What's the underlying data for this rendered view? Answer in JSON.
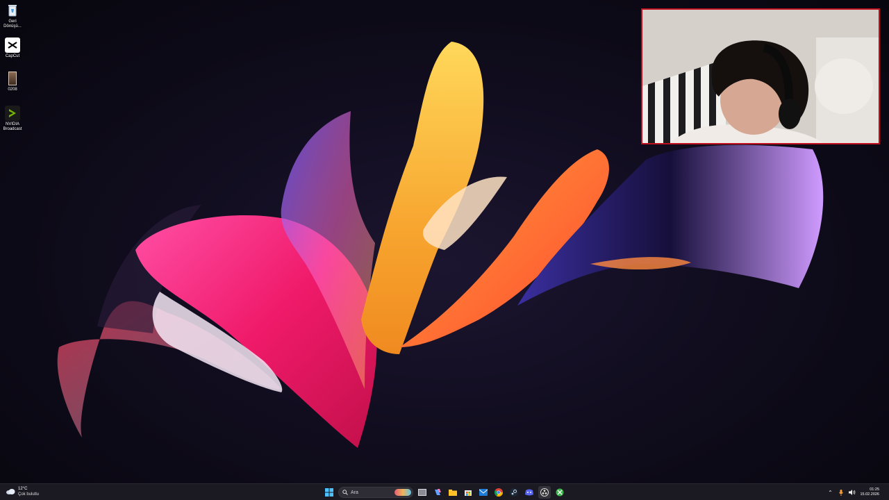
{
  "desktop": {
    "icons": [
      {
        "label": "Geri Dönüşü...",
        "icon": "recycle-bin-icon"
      },
      {
        "label": "CapCut",
        "icon": "capcut-icon"
      },
      {
        "label": "0208",
        "icon": "image-file-icon"
      },
      {
        "label": "NVIDIA Broadcast",
        "icon": "nvidia-broadcast-icon"
      }
    ]
  },
  "taskbar": {
    "weather": {
      "temp": "12°C",
      "condition": "Çok bulutlu",
      "icon": "cloud-icon"
    },
    "search": {
      "placeholder": "Ara"
    },
    "apps": [
      "start-icon",
      "task-view-icon",
      "copilot-icon",
      "file-explorer-icon",
      "store-icon",
      "mail-icon",
      "chrome-icon",
      "steam-icon",
      "discord-icon",
      "obs-icon",
      "xbox-icon"
    ],
    "tray": {
      "time": "01:25",
      "date": "15.02.2026"
    }
  },
  "colors": {
    "taskbar_bg": "#1b1a22",
    "webcam_border": "#c01020",
    "accent": "#f7a52f"
  }
}
